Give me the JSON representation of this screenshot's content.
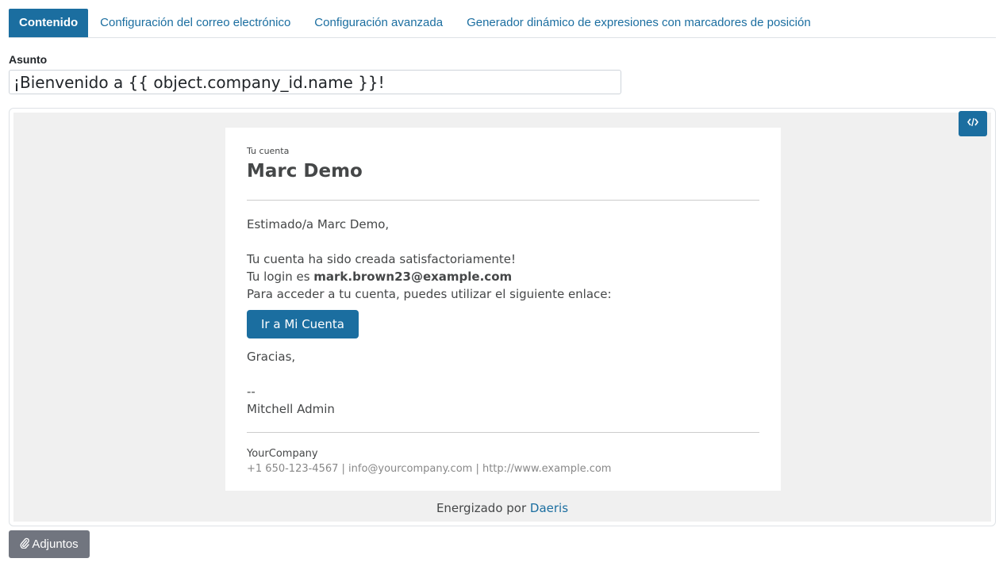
{
  "tabs": [
    {
      "label": "Contenido",
      "active": true
    },
    {
      "label": "Configuración del correo electrónico",
      "active": false
    },
    {
      "label": "Configuración avanzada",
      "active": false
    },
    {
      "label": "Generador dinámico de expresiones con marcadores de posición",
      "active": false
    }
  ],
  "subject": {
    "label": "Asunto",
    "value": "¡Bienvenido a {{ object.company_id.name }}!"
  },
  "editor": {
    "code_icon": "code-view-icon",
    "email": {
      "eyebrow": "Tu cuenta",
      "title": "Marc Demo",
      "greeting": "Estimado/a Marc Demo,",
      "line1": "Tu cuenta ha sido creada satisfactoriamente!",
      "login_prefix": "Tu login es ",
      "login_value": "mark.brown23@example.com",
      "line3": "Para acceder a tu cuenta, puedes utilizar el siguiente enlace:",
      "button_label": "Ir a Mi Cuenta",
      "thanks": "Gracias,",
      "signature_sep": "--",
      "signature_name": "Mitchell Admin",
      "company_name": "YourCompany",
      "company_contacts": "+1 650-123-4567 | info@yourcompany.com | http://www.example.com"
    },
    "powered_prefix": "Energizado por ",
    "powered_link": "Daeris"
  },
  "attachments": {
    "label": "Adjuntos",
    "icon": "paperclip-icon"
  },
  "colors": {
    "primary": "#1b6ea0",
    "secondary_button": "#71757f",
    "editor_bg": "#f0f0f0"
  }
}
